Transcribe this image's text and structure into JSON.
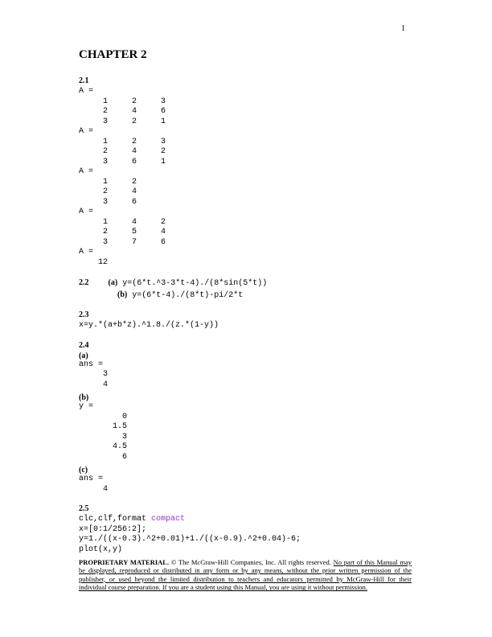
{
  "page_number": "1",
  "chapter_title": "CHAPTER 2",
  "sections": {
    "s21_label": "2.1",
    "s21_block": "A =\n     1     2     3\n     2     4     6\n     3     2     1\nA =\n     1     2     3\n     2     4     2\n     3     6     1\nA =\n     1     2\n     2     4\n     3     6\nA =\n     1     4     2\n     2     5     4\n     3     7     6\nA =\n    12",
    "s22_label": "2.2",
    "s22_a_prefix": "(a)",
    "s22_a_expr": "y=(6*t.^3-3*t-4)./(8*sin(5*t))",
    "s22_b_prefix": "(b)",
    "s22_b_expr": "y=(6*t-4)./(8*t)-pi/2*t",
    "s23_label": "2.3",
    "s23_expr": "x=y.*(a+b*z).^1.8./(z.*(1-y))",
    "s24_label": "2.4",
    "s24_a_label": "(a)",
    "s24_a_block": "ans =\n     3\n     4",
    "s24_b_label": "(b)",
    "s24_b_block": "y =\n         0\n       1.5\n         3\n       4.5\n         6",
    "s24_c_label": "(c)",
    "s24_c_block": "ans =\n     4",
    "s25_label": "2.5",
    "s25_line1a": "clc,clf,format ",
    "s25_line1b": "compact",
    "s25_line2": "x=[0:1/256:2];",
    "s25_line3": "y=1./((x-0.3).^2+0.01)+1./((x-0.9).^2+0.04)-6;",
    "s25_line4": "plot(x,y)"
  },
  "footer": {
    "lead_bold": "PROPRIETARY MATERIAL.",
    "copyright": "  © The McGraw-Hill Companies, Inc.  All rights reserved.  ",
    "underlined": "No part of this Manual may be displayed, reproduced or distributed in any form or by any means, without the prior written permission of the publisher, or used beyond the limited distribution to teachers and educators permitted by McGraw-Hill for their individual course preparation.  If you are a student using this Manual, you are using it without permission."
  }
}
